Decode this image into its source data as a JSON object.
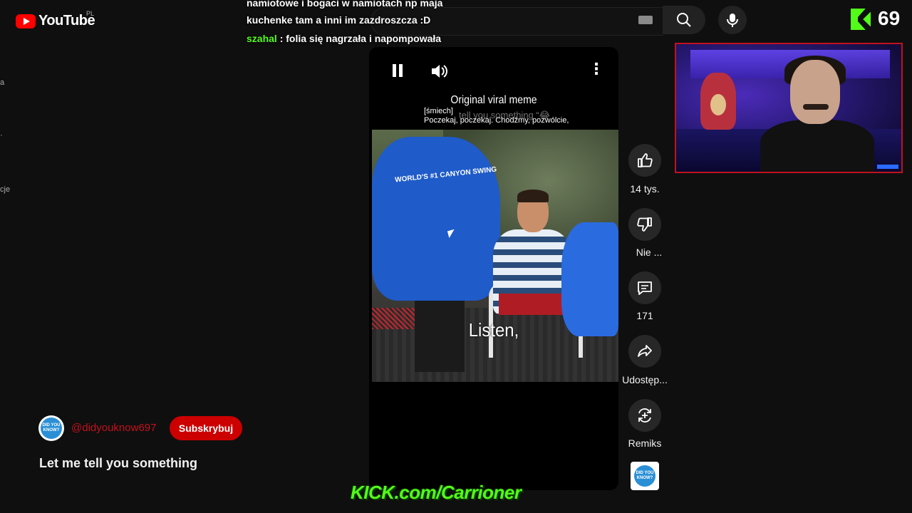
{
  "youtube": {
    "wordmark": "YouTube",
    "region": "PL"
  },
  "sidebar_fragments": [
    "a",
    "·",
    "cje"
  ],
  "chat": {
    "line1": "namiotowe i bogaci w namiotach np maja",
    "line2": "kuchenke tam a inni im zazdroszcza :D",
    "msg_user": "szahal",
    "msg_text": ": folia się nagrzała i napompowała"
  },
  "stream": {
    "viewers": "69",
    "url": "KICK.com/Carrioner"
  },
  "short": {
    "overlay_title": "Original viral meme",
    "ghost_text": "tell you something “😂",
    "sub_tag": "[śmiech]",
    "sub_line": "Poczekaj, poczekaj.  Chodźmy, pozwólcie,",
    "caption": "Listen,",
    "jacket_text": "WORLD'S #1 CANYON SWING",
    "title": "Let me tell you something"
  },
  "channel": {
    "handle": "@didyouknow697",
    "subscribe_label": "Subskrybuj",
    "avatar_text": "DID YOU KNOW?"
  },
  "actions": {
    "like_count": "14 tys.",
    "dislike_label": "Nie ...",
    "comments_count": "171",
    "share_label": "Udostęp...",
    "remix_label": "Remiks"
  },
  "colors": {
    "kick_green": "#53fc18",
    "yt_red": "#ff0000",
    "subscribe_red": "#cc0000",
    "webcam_border": "#c1121f"
  },
  "icons": [
    "youtube-logo-icon",
    "keyboard-icon",
    "search-icon",
    "mic-icon",
    "kick-logo-icon",
    "pause-icon",
    "volume-icon",
    "more-vert-icon",
    "like-icon",
    "dislike-icon",
    "comment-icon",
    "share-icon",
    "remix-icon"
  ]
}
